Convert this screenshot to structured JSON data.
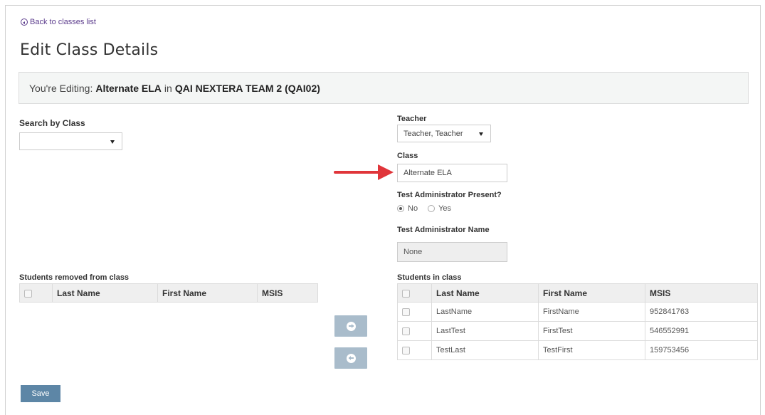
{
  "nav": {
    "back_label": "Back to classes list"
  },
  "page": {
    "title": "Edit Class Details"
  },
  "banner": {
    "prefix": "You're Editing:",
    "class_name": "Alternate ELA",
    "connector": "in",
    "team": "QAI NEXTERA TEAM 2 (QAI02)"
  },
  "search": {
    "label": "Search by Class",
    "selected": ""
  },
  "teacher": {
    "label": "Teacher",
    "selected": "Teacher, Teacher"
  },
  "class_field": {
    "label": "Class",
    "value": "Alternate ELA"
  },
  "test_admin_present": {
    "label": "Test Administrator Present?",
    "options": [
      {
        "label": "No",
        "checked": true
      },
      {
        "label": "Yes",
        "checked": false
      }
    ]
  },
  "test_admin_name": {
    "label": "Test Administrator Name",
    "value": "None"
  },
  "removed_table": {
    "title": "Students removed from class",
    "headers": [
      "Last Name",
      "First Name",
      "MSIS"
    ],
    "rows": []
  },
  "inclass_table": {
    "title": "Students in class",
    "headers": [
      "Last Name",
      "First Name",
      "MSIS"
    ],
    "rows": [
      [
        "LastName",
        "FirstName",
        "952841763"
      ],
      [
        "LastTest",
        "FirstTest",
        "546552991"
      ],
      [
        "TestLast",
        "TestFirst",
        "159753456"
      ]
    ]
  },
  "actions": {
    "save_label": "Save"
  },
  "colors": {
    "arrow": "#e0353a",
    "save_button": "#5d86a6",
    "link": "#5b3b8c",
    "move_button": "#a9bccb"
  },
  "icons": {
    "back": "circle-arrow-left-icon",
    "move_right": "circle-arrow-right-icon",
    "move_left": "circle-arrow-left-icon"
  }
}
